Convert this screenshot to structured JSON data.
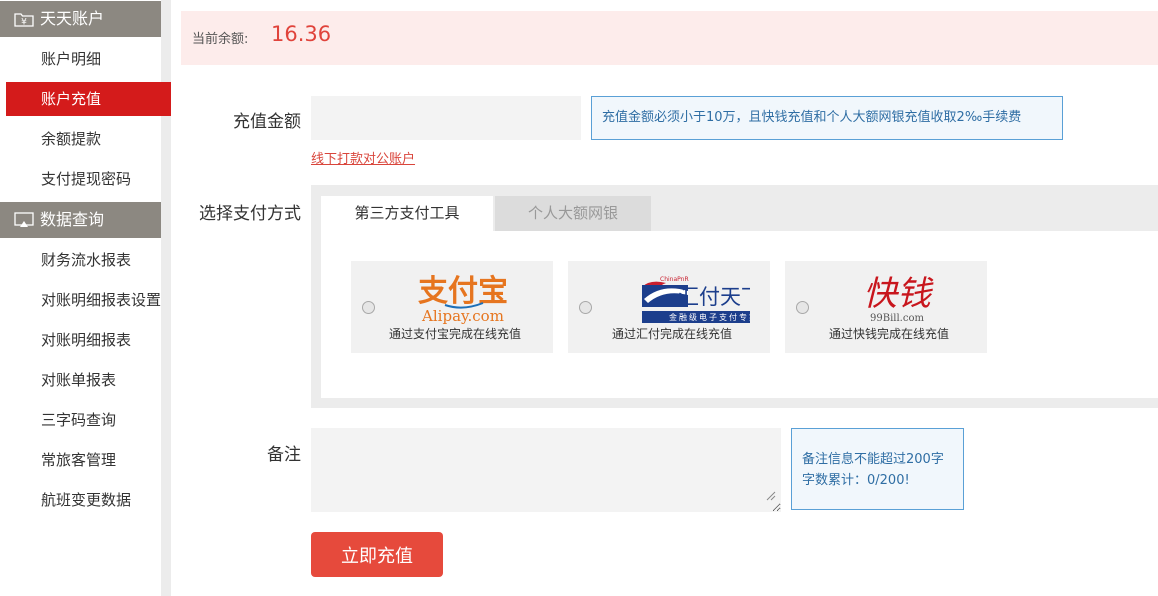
{
  "sidebar": {
    "sections": [
      {
        "title": "天天账户",
        "icon": "wallet-folder-icon",
        "items": [
          {
            "label": "账户明细"
          },
          {
            "label": "账户充值",
            "active": true
          },
          {
            "label": "余额提款"
          },
          {
            "label": "支付提现密码"
          }
        ]
      },
      {
        "title": "数据查询",
        "icon": "monitor-icon",
        "items": [
          {
            "label": "财务流水报表"
          },
          {
            "label": "对账明细报表设置"
          },
          {
            "label": "对账明细报表"
          },
          {
            "label": "对账单报表"
          },
          {
            "label": "三字码查询"
          },
          {
            "label": "常旅客管理"
          },
          {
            "label": "航班变更数据"
          }
        ]
      }
    ],
    "active_color": "#d41b1b",
    "header_color": "#8c8881"
  },
  "balance": {
    "label": "当前余额:",
    "value": "16.36"
  },
  "form": {
    "amount_label": "充值金额",
    "amount_value": "",
    "amount_tip": "充值金额必须小于10万，且快钱充值和个人大额网银充值收取2‰手续费",
    "offline_link": "线下打款对公账户",
    "pay_method_label": "选择支付方式",
    "tabs": [
      {
        "label": "第三方支付工具",
        "active": true
      },
      {
        "label": "个人大额网银",
        "active": false
      }
    ],
    "pay_options": [
      {
        "logo_text": "支付宝",
        "logo_sub": "Alipay.com",
        "caption": "通过支付宝完成在线充值",
        "icon": "alipay-logo"
      },
      {
        "logo_text": "汇付天下",
        "logo_sub": "金融级电子支付专家",
        "logo_mark": "ChinaPnR",
        "caption": "通过汇付完成在线充值",
        "icon": "chinapnr-logo"
      },
      {
        "logo_text": "快钱",
        "logo_sub": "99Bill.com",
        "caption": "通过快钱完成在线充值",
        "icon": "99bill-logo"
      }
    ],
    "remark_label": "备注",
    "remark_value": "",
    "remark_tip_line1": "备注信息不能超过200字",
    "remark_tip_line2": "字数累计：0/200!",
    "submit_label": "立即充值"
  },
  "colors": {
    "accent": "#e64a3c",
    "balance_bg": "#fdeceb",
    "tip_border": "#5aa0d6",
    "tip_text": "#2f6ea4"
  }
}
